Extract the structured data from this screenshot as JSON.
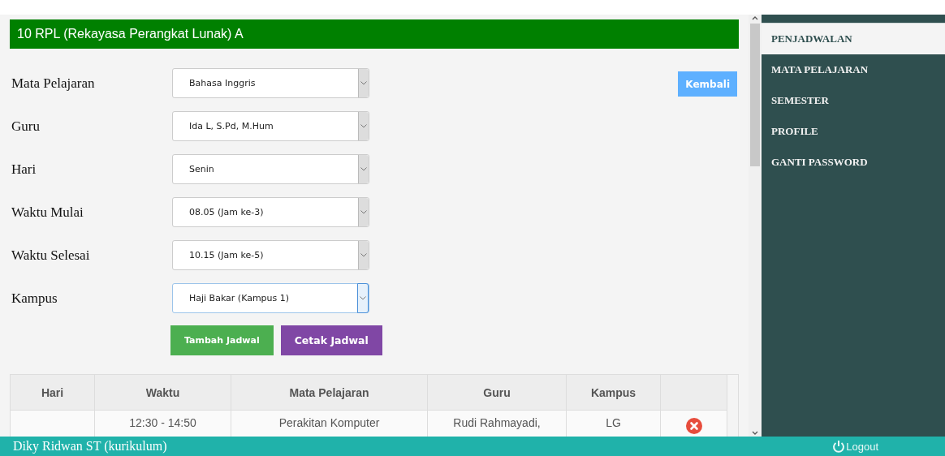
{
  "title": "10 RPL (Rekayasa Perangkat Lunak) A",
  "form": {
    "fields": [
      {
        "label": "Mata Pelajaran",
        "value": "Bahasa Inggris",
        "focused": false
      },
      {
        "label": "Guru",
        "value": "Ida L, S.Pd, M.Hum",
        "focused": false
      },
      {
        "label": "Hari",
        "value": "Senin",
        "focused": false
      },
      {
        "label": "Waktu Mulai",
        "value": "08.05 (Jam ke-3)",
        "focused": false
      },
      {
        "label": "Waktu Selesai",
        "value": "10.15 (Jam ke-5)",
        "focused": false
      },
      {
        "label": "Kampus",
        "value": "Haji Bakar (Kampus 1)",
        "focused": true
      }
    ],
    "back_button": "Kembali",
    "buttons": [
      {
        "label": "Tambah Jadwal",
        "kind": "add"
      },
      {
        "label": "Cetak Jadwal",
        "kind": "print"
      }
    ]
  },
  "table": {
    "columns": [
      "Hari",
      "Waktu",
      "Mata Pelajaran",
      "Guru",
      "Kampus"
    ],
    "rows": [
      {
        "cells": [
          "",
          "12:30 - 14:50",
          "Perakitan Komputer",
          "Rudi Rahmayadi,",
          "LG"
        ]
      }
    ]
  },
  "sidebar": {
    "items": [
      {
        "label": "PENJADWALAN",
        "selected": true
      },
      {
        "label": "MATA PELAJARAN",
        "selected": false
      },
      {
        "label": "SEMESTER",
        "selected": false
      },
      {
        "label": "PROFILE",
        "selected": false
      },
      {
        "label": "GANTI PASSWORD",
        "selected": false
      }
    ]
  },
  "status_bar": {
    "user": "Diky Ridwan ST (kurikulum)",
    "logout": "Logout"
  }
}
